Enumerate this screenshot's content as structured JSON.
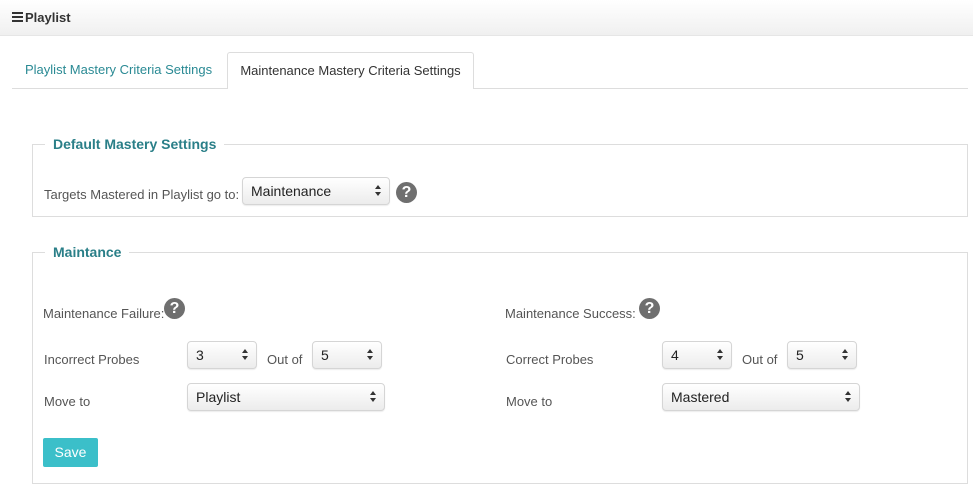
{
  "header": {
    "title": "Playlist",
    "menu_icon": "hamburger-menu-icon"
  },
  "tabs": [
    {
      "label": "Playlist Mastery Criteria Settings",
      "active": false
    },
    {
      "label": "Maintenance Mastery Criteria Settings",
      "active": true
    }
  ],
  "default_settings": {
    "legend": "Default Mastery Settings",
    "targets_label": "Targets Mastered in Playlist go to:",
    "targets_value": "Maintenance",
    "help_glyph": "?"
  },
  "maintance": {
    "legend": "Maintance",
    "failure": {
      "heading": "Maintenance Failure:",
      "probes_label": "Incorrect Probes",
      "probes_value": "3",
      "out_of_label": "Out of",
      "out_of_value": "5",
      "move_to_label": "Move to",
      "move_to_value": "Playlist"
    },
    "success": {
      "heading": "Maintenance Success:",
      "probes_label": "Correct Probes",
      "probes_value": "4",
      "out_of_label": "Out of",
      "out_of_value": "5",
      "move_to_label": "Move to",
      "move_to_value": "Mastered"
    },
    "help_glyph": "?",
    "save_label": "Save"
  },
  "colors": {
    "accent": "#2a8a94",
    "save_button": "#3bbfc9",
    "help_icon": "#6f6f6f"
  }
}
